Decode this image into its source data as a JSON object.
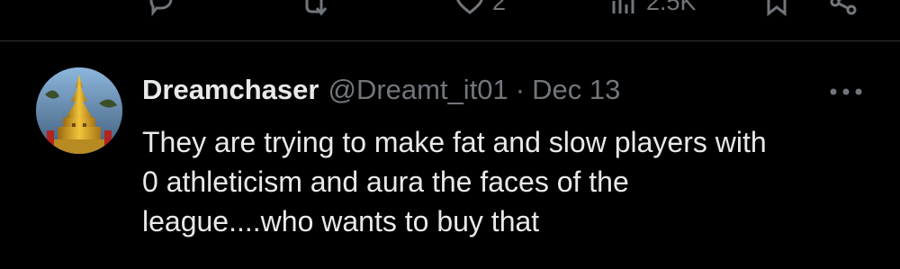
{
  "previous_tweet": {
    "actions": [
      {
        "icon": "reply-icon",
        "count": ""
      },
      {
        "icon": "repost-icon",
        "count": ""
      },
      {
        "icon": "like-icon",
        "count": "2"
      },
      {
        "icon": "views-icon",
        "count": "2.5K"
      },
      {
        "icon": "bookmark-icon",
        "count": ""
      },
      {
        "icon": "share-icon",
        "count": ""
      }
    ]
  },
  "tweet": {
    "display_name": "Dreamchaser",
    "handle": "@Dreamt_it01",
    "separator": "·",
    "date": "Dec 13",
    "text_lines": [
      "They are trying to make fat and slow players with",
      "0 athleticism and aura the faces of the",
      "league....who wants to buy that"
    ]
  },
  "colors": {
    "background": "#000000",
    "primary_text": "#e7e9ea",
    "secondary_text": "#71767b",
    "divider": "#2f3336"
  }
}
